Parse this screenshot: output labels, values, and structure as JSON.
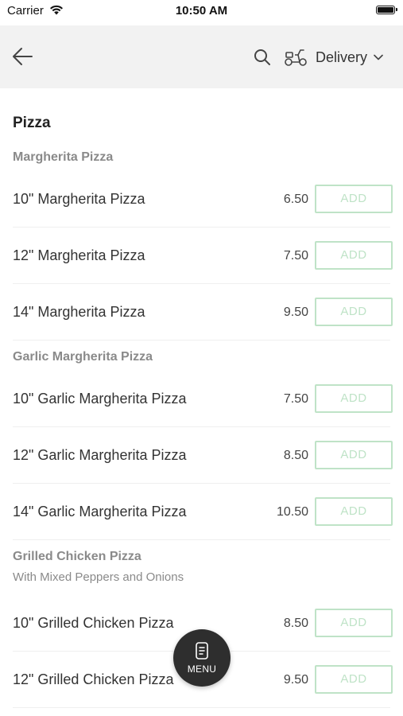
{
  "status": {
    "carrier": "Carrier",
    "time": "10:50 AM"
  },
  "nav": {
    "delivery_label": "Delivery"
  },
  "section": {
    "title": "Pizza"
  },
  "groups": [
    {
      "title": "Margherita Pizza",
      "items": [
        {
          "name": "10\" Margherita Pizza",
          "price": "6.50",
          "button": "ADD"
        },
        {
          "name": "12\" Margherita Pizza",
          "price": "7.50",
          "button": "ADD"
        },
        {
          "name": "14\" Margherita Pizza",
          "price": "9.50",
          "button": "ADD"
        }
      ]
    },
    {
      "title": "Garlic Margherita Pizza",
      "items": [
        {
          "name": "10\" Garlic Margherita Pizza",
          "price": "7.50",
          "button": "ADD"
        },
        {
          "name": "12\" Garlic Margherita Pizza",
          "price": "8.50",
          "button": "ADD"
        },
        {
          "name": "14\" Garlic Margherita Pizza",
          "price": "10.50",
          "button": "ADD"
        }
      ]
    },
    {
      "title": "Grilled Chicken Pizza",
      "subtitle": "With Mixed Peppers and Onions",
      "items": [
        {
          "name": "10\" Grilled Chicken Pizza",
          "price": "8.50",
          "button": "ADD"
        },
        {
          "name": "12\" Grilled Chicken Pizza",
          "price": "9.50",
          "button": "ADD"
        }
      ]
    }
  ],
  "fab": {
    "label": "MENU"
  },
  "colors": {
    "add_button": "#bfe3c7",
    "nav_background": "#f2f2f2",
    "fab_background": "#2e2e2e"
  }
}
